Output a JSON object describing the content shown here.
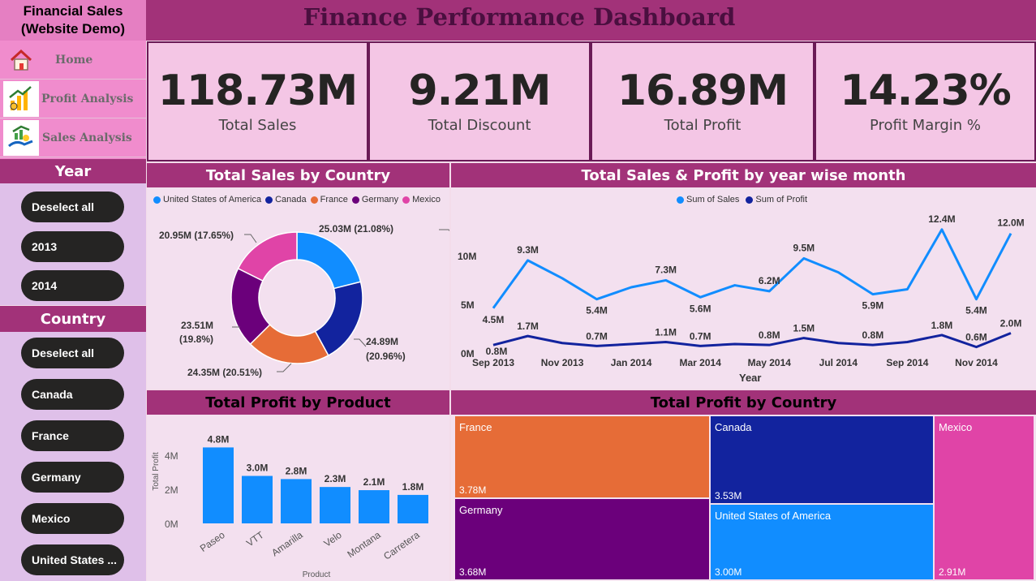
{
  "app": {
    "name_line1": "Financial Sales",
    "name_line2": "(Website Demo)",
    "title": "Finance Performance Dashboard"
  },
  "nav": [
    {
      "label": "Home",
      "icon": "home-icon"
    },
    {
      "label": "Profit Analysis",
      "icon": "profit-chart-icon"
    },
    {
      "label": "Sales Analysis",
      "icon": "sales-growth-icon"
    }
  ],
  "year_slicer": {
    "title": "Year",
    "items": [
      "Deselect all",
      "2013",
      "2014"
    ]
  },
  "country_slicer": {
    "title": "Country",
    "items": [
      "Deselect all",
      "Canada",
      "France",
      "Germany",
      "Mexico",
      "United States ..."
    ]
  },
  "kpis": [
    {
      "value": "118.73M",
      "label": "Total Sales"
    },
    {
      "value": "9.21M",
      "label": "Total Discount"
    },
    {
      "value": "16.89M",
      "label": "Total Profit"
    },
    {
      "value": "14.23%",
      "label": "Profit Margin %"
    }
  ],
  "donut": {
    "title": "Total Sales by Country",
    "legend": [
      "United States of America",
      "Canada",
      "France",
      "Germany",
      "Mexico"
    ],
    "labels": [
      "25.03M (21.08%)",
      "24.89M",
      "(20.96%)",
      "24.35M (20.51%)",
      "23.51M",
      "(19.8%)",
      "20.95M (17.65%)"
    ]
  },
  "line": {
    "title": "Total Sales & Profit by year wise month",
    "legend": [
      "Sum of  Sales",
      "Sum of Profit"
    ],
    "xlabel": "Year",
    "yticks": [
      "10M",
      "5M",
      "0M"
    ],
    "xticks": [
      "Sep 2013",
      "Nov 2013",
      "Jan 2014",
      "Mar 2014",
      "May 2014",
      "Jul 2014",
      "Sep 2014",
      "Nov 2014"
    ],
    "sales_labels": [
      "4.5M",
      "9.3M",
      "5.4M",
      "7.3M",
      "5.6M",
      "6.2M",
      "9.5M",
      "5.9M",
      "12.4M",
      "5.4M",
      "12.0M"
    ],
    "profit_labels": [
      "0.8M",
      "1.7M",
      "0.7M",
      "1.1M",
      "0.7M",
      "0.8M",
      "1.5M",
      "0.8M",
      "1.8M",
      "0.6M",
      "2.0M"
    ]
  },
  "bars": {
    "title": "Total Profit by Product",
    "ylabel": "Total Profit",
    "xlabel": "Product",
    "yticks": [
      "4M",
      "2M",
      "0M"
    ]
  },
  "treemap": {
    "title": "Total Profit by Country",
    "cells": [
      {
        "name": "France",
        "value": "3.78M"
      },
      {
        "name": "Germany",
        "value": "3.68M"
      },
      {
        "name": "Canada",
        "value": "3.53M"
      },
      {
        "name": "United States of America",
        "value": "3.00M"
      },
      {
        "name": "Mexico",
        "value": "2.91M"
      }
    ]
  },
  "colors": {
    "usa": "#118dff",
    "canada": "#12239e",
    "france": "#e66c37",
    "germany": "#6b007b",
    "mexico": "#e044a7",
    "header": "#a23279"
  },
  "chart_data": [
    {
      "type": "pie",
      "title": "Total Sales by Country",
      "categories": [
        "United States of America",
        "Canada",
        "France",
        "Germany",
        "Mexico"
      ],
      "values": [
        25.03,
        24.89,
        24.35,
        23.51,
        20.95
      ],
      "percent": [
        21.08,
        20.96,
        20.51,
        19.8,
        17.65
      ],
      "unit": "M"
    },
    {
      "type": "line",
      "title": "Total Sales & Profit by year wise month",
      "xlabel": "Year",
      "x": [
        "Sep 2013",
        "Oct 2013",
        "Nov 2013",
        "Dec 2013",
        "Jan 2014",
        "Feb 2014",
        "Mar 2014",
        "Apr 2014",
        "May 2014",
        "Jun 2014",
        "Jul 2014",
        "Aug 2014",
        "Sep 2014",
        "Oct 2014",
        "Nov 2014",
        "Dec 2014"
      ],
      "ylim": [
        0,
        13
      ],
      "series": [
        {
          "name": "Sum of  Sales",
          "values": [
            4.5,
            9.3,
            7.5,
            5.4,
            6.6,
            7.3,
            5.6,
            6.8,
            6.2,
            9.5,
            8.1,
            5.9,
            6.4,
            12.4,
            5.4,
            12.0
          ]
        },
        {
          "name": "Sum of Profit",
          "values": [
            0.8,
            1.7,
            1.0,
            0.7,
            0.9,
            1.1,
            0.7,
            0.9,
            0.8,
            1.5,
            1.0,
            0.8,
            1.1,
            1.8,
            0.6,
            2.0
          ]
        }
      ]
    },
    {
      "type": "bar",
      "title": "Total Profit by Product",
      "xlabel": "Product",
      "ylabel": "Total Profit",
      "categories": [
        "Paseo",
        "VTT",
        "Amarilla",
        "Velo",
        "Montana",
        "Carretera"
      ],
      "values": [
        4.8,
        3.0,
        2.8,
        2.3,
        2.1,
        1.8
      ],
      "value_labels": [
        "4.8M",
        "3.0M",
        "2.8M",
        "2.3M",
        "2.1M",
        "1.8M"
      ],
      "ylim": [
        0,
        5
      ]
    },
    {
      "type": "treemap",
      "title": "Total Profit by Country",
      "categories": [
        "France",
        "Germany",
        "Canada",
        "United States of America",
        "Mexico"
      ],
      "values": [
        3.78,
        3.68,
        3.53,
        3.0,
        2.91
      ],
      "unit": "M"
    }
  ]
}
